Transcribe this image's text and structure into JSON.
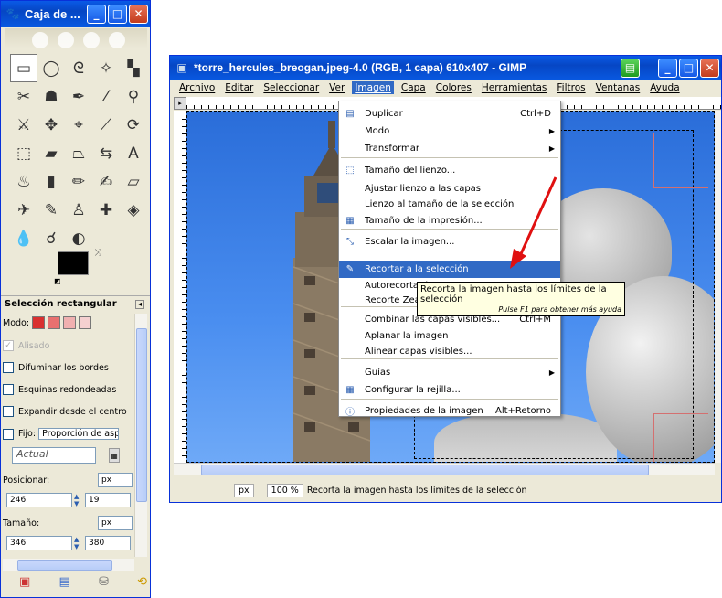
{
  "toolbox": {
    "title": "Caja de ...",
    "title_icon": "gimp-wilber-icon",
    "tools": [
      {
        "icon": "rect-select-icon",
        "glyph": "▭"
      },
      {
        "icon": "ellipse-select-icon",
        "glyph": "◯"
      },
      {
        "icon": "free-select-icon",
        "glyph": "ᘓ"
      },
      {
        "icon": "fuzzy-select-icon",
        "glyph": "✧"
      },
      {
        "icon": "select-by-color-icon",
        "glyph": "▚"
      },
      {
        "icon": "scissors-icon",
        "glyph": "✂"
      },
      {
        "icon": "foreground-select-icon",
        "glyph": "☗"
      },
      {
        "icon": "paths-icon",
        "glyph": "✒"
      },
      {
        "icon": "color-picker-icon",
        "glyph": "⁄"
      },
      {
        "icon": "zoom-icon",
        "glyph": "⚲"
      },
      {
        "icon": "measure-icon",
        "glyph": "⚔"
      },
      {
        "icon": "move-icon",
        "glyph": "✥"
      },
      {
        "icon": "align-icon",
        "glyph": "⌖"
      },
      {
        "icon": "crop-icon",
        "glyph": "⟋"
      },
      {
        "icon": "rotate-icon",
        "glyph": "⟳"
      },
      {
        "icon": "scale-icon",
        "glyph": "⬚"
      },
      {
        "icon": "shear-icon",
        "glyph": "▰"
      },
      {
        "icon": "perspective-icon",
        "glyph": "⏢"
      },
      {
        "icon": "flip-icon",
        "glyph": "⇆"
      },
      {
        "icon": "text-icon",
        "glyph": "A"
      },
      {
        "icon": "bucket-fill-icon",
        "glyph": "♨"
      },
      {
        "icon": "blend-icon",
        "glyph": "▮"
      },
      {
        "icon": "pencil-icon",
        "glyph": "✏"
      },
      {
        "icon": "paintbrush-icon",
        "glyph": "✍"
      },
      {
        "icon": "eraser-icon",
        "glyph": "▱"
      },
      {
        "icon": "airbrush-icon",
        "glyph": "✈"
      },
      {
        "icon": "ink-icon",
        "glyph": "✎"
      },
      {
        "icon": "clone-icon",
        "glyph": "♙"
      },
      {
        "icon": "heal-icon",
        "glyph": "✚"
      },
      {
        "icon": "perspective-clone-icon",
        "glyph": "◈"
      },
      {
        "icon": "blur-icon",
        "glyph": "💧"
      },
      {
        "icon": "smudge-icon",
        "glyph": "☌"
      },
      {
        "icon": "dodge-burn-icon",
        "glyph": "◐"
      }
    ],
    "options": {
      "header": "Selección rectangular",
      "mode_label": "Modo:",
      "antialias": "Alisado",
      "feather": "Difuminar los bordes",
      "rounded": "Esquinas redondeadas",
      "expand_center": "Expandir desde el centro",
      "fixed_label": "Fijo:",
      "fixed_value": "Proporción de aspecto",
      "current_value": "Actual",
      "position_label": "Posicionar:",
      "position_unit": "px",
      "position_x": "246",
      "position_y": "19",
      "size_label": "Tamaño:",
      "size_unit": "px",
      "size_w": "346",
      "size_h": "380"
    },
    "colors": {
      "fg": "#000000",
      "bg": "#ffffff"
    }
  },
  "image_window": {
    "title": "*torre_hercules_breogan.jpeg-4.0 (RGB, 1 capa) 610x407 - GIMP",
    "menus": [
      "Archivo",
      "Editar",
      "Seleccionar",
      "Ver",
      "Imagen",
      "Capa",
      "Colores",
      "Herramientas",
      "Filtros",
      "Ventanas",
      "Ayuda"
    ],
    "active_menu": "Imagen",
    "status": {
      "unit": "px",
      "zoom": "100 %",
      "message": "Recorta la imagen hasta los límites de la selección"
    }
  },
  "imagen_menu": {
    "items": [
      {
        "label": "Duplicar",
        "accel": "Ctrl+D",
        "icon": "duplicate-icon"
      },
      {
        "label": "Modo",
        "submenu": true
      },
      {
        "label": "Transformar",
        "submenu": true
      },
      {
        "label": "Tamaño del lienzo...",
        "icon": "canvas-size-icon"
      },
      {
        "label": "Ajustar lienzo a las capas"
      },
      {
        "label": "Lienzo al tamaño de la selección"
      },
      {
        "label": "Tamaño de la impresión...",
        "icon": "print-size-icon"
      },
      {
        "label": "Escalar la imagen...",
        "icon": "scale-image-icon"
      },
      {
        "label": "Recortar a la selección",
        "icon": "crop-knife-icon",
        "highlighted": true
      },
      {
        "label": "Autorecortar imagen"
      },
      {
        "label": "Recorte Zealous"
      },
      {
        "label": "Combinar las capas visibles...",
        "accel": "Ctrl+M"
      },
      {
        "label": "Aplanar la imagen"
      },
      {
        "label": "Alinear capas visibles..."
      },
      {
        "label": "Guías",
        "submenu": true
      },
      {
        "label": "Configurar la rejilla...",
        "icon": "grid-icon"
      },
      {
        "label": "Propiedades de la imagen",
        "accel": "Alt+Retorno",
        "icon": "info-icon"
      }
    ],
    "tooltip": {
      "text": "Recorta la imagen hasta los límites de la selección",
      "hint": "Pulse F1 para obtener más ayuda"
    }
  },
  "colors": {
    "xp_title": "#0a5ae6",
    "menu_highlight": "#316ac5",
    "annotation_arrow": "#e01010",
    "sky": "#3b80e8"
  }
}
